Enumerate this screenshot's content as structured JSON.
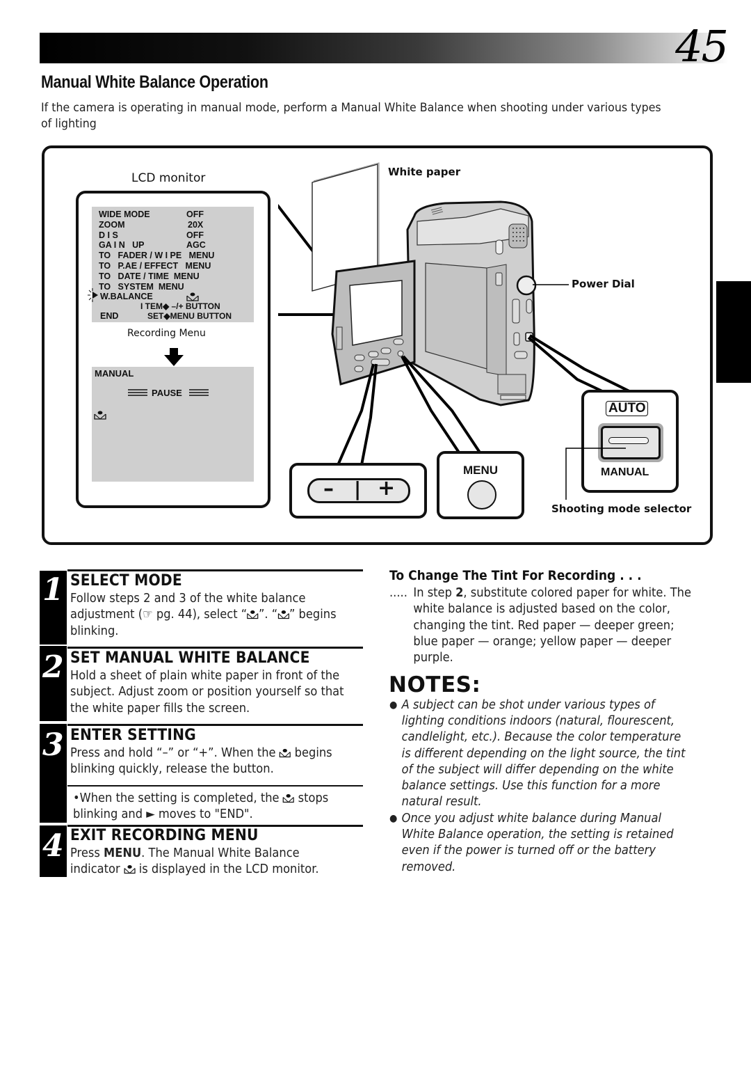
{
  "page": {
    "number": "45",
    "section_title": "Manual White Balance Operation",
    "intro": "If the camera is operating in manual mode, perform a Manual White Balance when shooting under various types of lighting"
  },
  "diagram": {
    "lcd_monitor_label": "LCD monitor",
    "recording_menu_label": "Recording Menu",
    "menu_screen": {
      "rows": [
        {
          "item": "WIDE MODE",
          "value": "OFF"
        },
        {
          "item": "ZOOM",
          "value": "20X"
        },
        {
          "item": "D I S",
          "value": "OFF"
        },
        {
          "item": "GA I N   UP",
          "value": "AGC"
        },
        {
          "item": "TO   FADER / W I PE   MENU",
          "value": ""
        },
        {
          "item": "TO   P.AE / EFFECT   MENU",
          "value": ""
        },
        {
          "item": "TO   DATE / TIME  MENU",
          "value": ""
        },
        {
          "item": "TO   SYSTEM  MENU",
          "value": ""
        },
        {
          "item": "W.BALANCE",
          "value": "manual-wb-icon"
        }
      ],
      "hint_item": "I TEM◆ –/+ BUTTON",
      "end_label": "END",
      "hint_set": "SET◆MENU BUTTON",
      "cursor": "▶"
    },
    "pause_screen": {
      "mode": "MANUAL",
      "status": "PAUSE",
      "indicator": "manual-wb-icon"
    },
    "white_paper_label": "White paper",
    "power_dial_label": "Power Dial",
    "plus_minus_button": {
      "minus": "–",
      "divider": "|",
      "plus": "+"
    },
    "menu_button_label": "MENU",
    "mode_selector": {
      "auto_label": "AUTO",
      "manual_label": "MANUAL",
      "caption": "Shooting mode selector"
    }
  },
  "steps": [
    {
      "number": "1",
      "title": "SELECT MODE",
      "body_parts": [
        "Follow steps 2 and 3 of the white balance adjustment (",
        "☞",
        " pg. 44), select “",
        "”. “",
        "” begins blinking."
      ]
    },
    {
      "number": "2",
      "title": "SET MANUAL WHITE BALANCE",
      "body": "Hold a sheet of plain white paper in front of the subject. Adjust zoom or position yourself so that the white paper fills the screen."
    },
    {
      "number": "3",
      "title": "ENTER SETTING",
      "body_parts": [
        "Press and hold “–” or “+”. When the ",
        " begins blinking quickly, release the button."
      ],
      "note_parts": [
        "•When the setting is completed, the ",
        " stops blinking and ► moves to \"END\"."
      ]
    },
    {
      "number": "4",
      "title": "EXIT RECORDING MENU",
      "body_parts": [
        "Press ",
        "MENU",
        ". The Manual White Balance indicator ",
        " is displayed in the LCD monitor."
      ]
    }
  ],
  "tint": {
    "title": "To Change The Tint For Recording . . .",
    "lead": ".....",
    "body_parts": [
      "In step ",
      "2",
      ", substitute colored paper for white. The white balance is adjusted based on the color, changing the tint. Red paper — deeper green; blue paper — orange; yellow paper — deeper purple."
    ]
  },
  "notes": {
    "heading": "NOTES:",
    "bullet": "●",
    "items": [
      "A subject can be shot under various types of lighting conditions indoors (natural, flourescent, candlelight, etc.). Because the color temperature is different depending on the light source, the tint of the subject will differ depending on the white balance settings. Use this function for a more natural result.",
      "Once you adjust white balance during Manual White Balance operation, the setting is retained even if the power is turned off or the battery removed."
    ]
  }
}
